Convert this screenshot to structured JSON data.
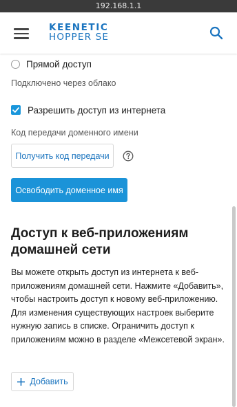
{
  "browser": {
    "url": "192.168.1.1"
  },
  "header": {
    "logo_line1": "KEENETIC",
    "logo_line2": "HOPPER SE",
    "brand_color": "#1a74bf"
  },
  "access": {
    "direct_label": "Прямой доступ",
    "direct_checked": false,
    "cloud_status": "Подключено через облако",
    "allow_internet_label": "Разрешить доступ из интернета",
    "allow_internet_checked": true,
    "transfer_code_label": "Код передачи доменного имени",
    "get_code_button": "Получить код передачи",
    "release_domain_button": "Освободить доменное имя"
  },
  "web_apps": {
    "title": "Доступ к веб-приложениям домашней сети",
    "description": "Вы можете открыть доступ из интернета к веб-приложениям домашней сети. Нажмите «Добавить», чтобы настроить доступ к новому веб-приложению. Для изменения существующих настроек выберите нужную запись в списке. Ограничить доступ к приложениям можно в разделе «Межсетевой экран».",
    "add_button": "Добавить"
  },
  "icons": [
    "menu-icon",
    "search-icon",
    "help-icon",
    "plus-icon",
    "check-icon"
  ],
  "colors": {
    "accent": "#1b93d8",
    "link": "#1a74bf"
  }
}
